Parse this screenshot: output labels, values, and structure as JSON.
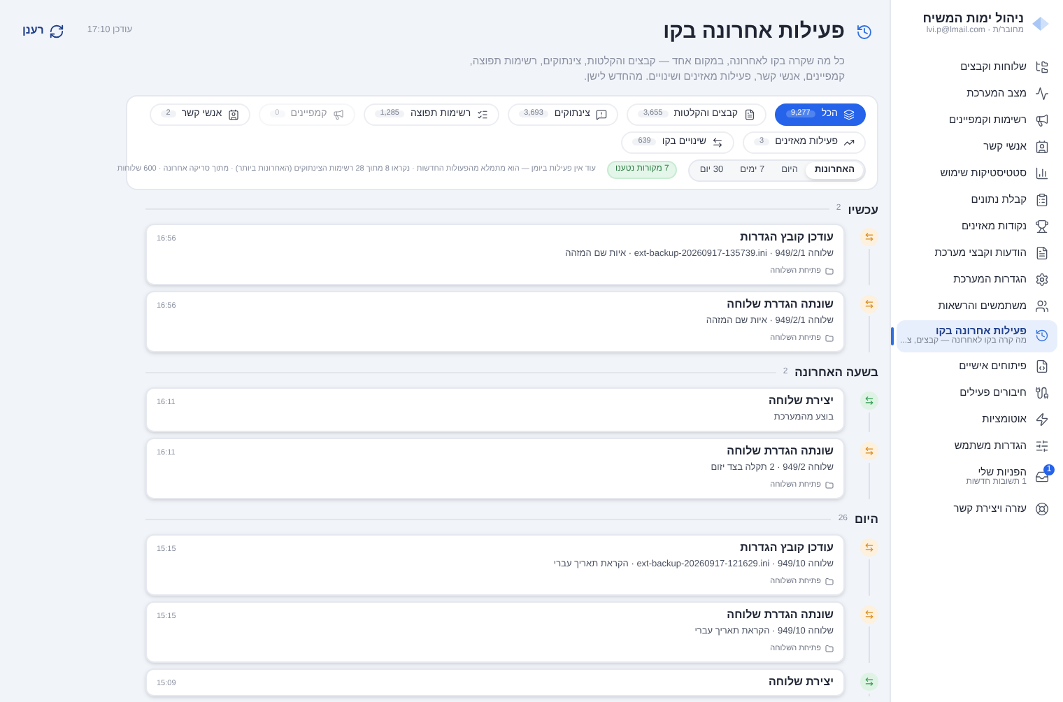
{
  "sidebar": {
    "app_title": "ניהול ימות המשיח",
    "account": "מחובר/ת · lvi.p@lmail.com",
    "items": [
      {
        "label": "שלוחות וקבצים",
        "selected": false
      },
      {
        "label": "מצב המערכת",
        "selected": false
      },
      {
        "label": "רשימות וקמפיינים",
        "selected": false
      },
      {
        "label": "אנשי קשר",
        "selected": false
      },
      {
        "label": "סטטיסטיקות שימוש",
        "selected": false
      },
      {
        "label": "קבלת נתונים",
        "selected": false
      },
      {
        "label": "נקודות מאזינים",
        "selected": false
      },
      {
        "label": "הודעות וקבצי מערכת",
        "selected": false
      },
      {
        "label": "הגדרות המערכת",
        "selected": false
      },
      {
        "label": "משתמשים והרשאות",
        "selected": false
      },
      {
        "label": "פעילות אחרונה בקו",
        "subtitle": "מה קרה בקו לאחרונה — קבצים, צ...",
        "selected": true
      },
      {
        "label": "פיתוחים אישיים",
        "selected": false
      },
      {
        "label": "חיבורים פעילים",
        "selected": false
      },
      {
        "label": "אוטומציות",
        "selected": false
      },
      {
        "label": "הגדרות משתמש",
        "selected": false
      },
      {
        "label": "הפניות שלי",
        "subtitle": "1 תשובות חדשות",
        "badge": "1",
        "selected": false
      },
      {
        "label": "עזרה ויצירת קשר",
        "selected": false
      }
    ]
  },
  "header": {
    "title": "פעילות אחרונה בקו",
    "description": "כל מה שקרה בקו לאחרונה, במקום אחד — קבצים והקלטות, צינתוקים, רשימות תפוצה, קמפיינים, אנשי קשר, פעילות מאזינים ושינויים. מהחדש לישן.",
    "updated": "עודכן 17:10",
    "refresh_button": "רענן"
  },
  "filters": {
    "chips": [
      {
        "label": "הכל",
        "count": "9,277",
        "selected": true,
        "disabled": false
      },
      {
        "label": "קבצים והקלטות",
        "count": "3,655",
        "selected": false,
        "disabled": false
      },
      {
        "label": "צינתוקים",
        "count": "3,693",
        "selected": false,
        "disabled": false
      },
      {
        "label": "רשימות תפוצה",
        "count": "1,285",
        "selected": false,
        "disabled": false
      },
      {
        "label": "קמפיינים",
        "count": "0",
        "selected": false,
        "disabled": true
      },
      {
        "label": "אנשי קשר",
        "count": "2",
        "selected": false,
        "disabled": false
      },
      {
        "label": "פעילות מאזינים",
        "count": "3",
        "selected": false,
        "disabled": false
      },
      {
        "label": "שינויים בקו",
        "count": "639",
        "selected": false,
        "disabled": false
      }
    ],
    "ranges": [
      {
        "label": "האחרונות",
        "selected": true
      },
      {
        "label": "היום",
        "selected": false
      },
      {
        "label": "7 ימים",
        "selected": false
      },
      {
        "label": "30 יום",
        "selected": false
      }
    ],
    "sources_badge": "7 מקורות נטענו",
    "note": "עוד אין פעילות ביומן — הוא מתמלא מהפעולות החדשות · נקראו 8 מתוך 28 רשימות הצינתוקים (האחרונות ביותר) · מתוך סריקה אחרונה · 600 שלוחות"
  },
  "groups": [
    {
      "title": "עכשיו",
      "count": "2",
      "items": [
        {
          "kind": "update",
          "title": "עודכן קובץ הגדרות",
          "detail": "שלוחה 949/2/1 · ext-backup-20260917-135739.ini · איות שם המזהה",
          "link": "פתיחת השלוחה",
          "time": "16:56"
        },
        {
          "kind": "update",
          "title": "שונתה הגדרת שלוחה",
          "detail": "שלוחה 949/2/1 · איות שם המזהה",
          "link": "פתיחת השלוחה",
          "time": "16:56"
        }
      ]
    },
    {
      "title": "בשעה האחרונה",
      "count": "2",
      "items": [
        {
          "kind": "create",
          "title": "יצירת שלוחה",
          "detail": "בוצע מהמערכת",
          "time": "16:11"
        },
        {
          "kind": "update",
          "title": "שונתה הגדרת שלוחה",
          "detail": "שלוחה 949/2 · 2 תקלה בצד יזום",
          "link": "פתיחת השלוחה",
          "time": "16:11"
        }
      ]
    },
    {
      "title": "היום",
      "count": "26",
      "items": [
        {
          "kind": "update",
          "title": "עודכן קובץ הגדרות",
          "detail": "שלוחה 949/10 · ext-backup-20260917-121629.ini · הקראת תאריך עברי",
          "link": "פתיחת השלוחה",
          "time": "15:15"
        },
        {
          "kind": "update",
          "title": "שונתה הגדרת שלוחה",
          "detail": "שלוחה 949/10 · הקראת תאריך עברי",
          "link": "פתיחת השלוחה",
          "time": "15:15"
        },
        {
          "kind": "create",
          "title": "יצירת שלוחה",
          "time": "15:09"
        }
      ]
    }
  ]
}
